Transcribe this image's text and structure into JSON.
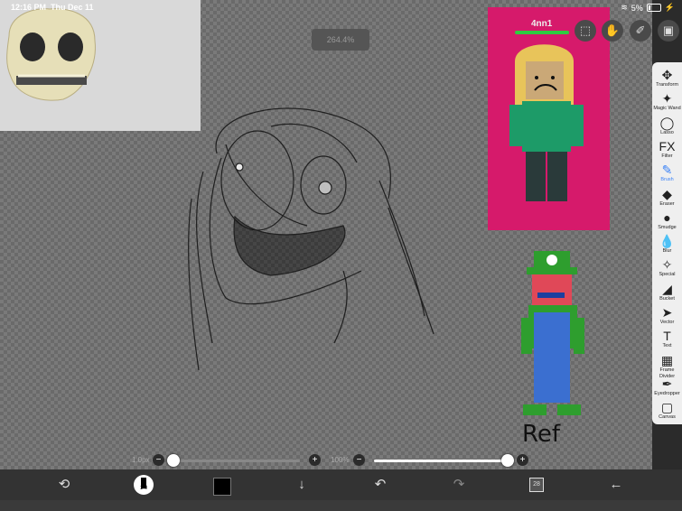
{
  "status_bar": {
    "time": "12:16 PM",
    "date": "Thu Dec 11",
    "battery": "5%"
  },
  "zoom": {
    "value": "264.4%"
  },
  "roblox_ref": {
    "name": "4nn1"
  },
  "tools": [
    {
      "label": "Transform",
      "icon": "transform-icon",
      "glyph": "✥"
    },
    {
      "label": "Magic Wand",
      "icon": "magic-wand-icon",
      "glyph": "✦"
    },
    {
      "label": "Lasso",
      "icon": "lasso-icon",
      "glyph": "◯"
    },
    {
      "label": "Filter",
      "icon": "filter-icon",
      "glyph": "FX"
    },
    {
      "label": "Brush",
      "icon": "brush-icon",
      "glyph": "✎"
    },
    {
      "label": "Eraser",
      "icon": "eraser-icon",
      "glyph": "◆"
    },
    {
      "label": "Smudge",
      "icon": "smudge-icon",
      "glyph": "●"
    },
    {
      "label": "Blur",
      "icon": "blur-icon",
      "glyph": "💧"
    },
    {
      "label": "Special",
      "icon": "special-icon",
      "glyph": "✧"
    },
    {
      "label": "Bucket",
      "icon": "bucket-icon",
      "glyph": "◢"
    },
    {
      "label": "Vector",
      "icon": "vector-icon",
      "glyph": "➤"
    },
    {
      "label": "Text",
      "icon": "text-icon",
      "glyph": "T"
    },
    {
      "label": "Frame Divider",
      "icon": "frame-divider-icon",
      "glyph": "▦"
    },
    {
      "label": "Eyedropper",
      "icon": "eyedropper-icon",
      "glyph": "✒"
    },
    {
      "label": "Canvas",
      "icon": "canvas-icon",
      "glyph": "▢"
    }
  ],
  "active_tool": "Brush",
  "brush_size": {
    "value": "1.0px",
    "indicator": "1.0",
    "level": 0.0
  },
  "opacity": {
    "value": "100%",
    "level": 1.0
  },
  "layers": {
    "count": "28"
  },
  "ref_label": "Ref"
}
